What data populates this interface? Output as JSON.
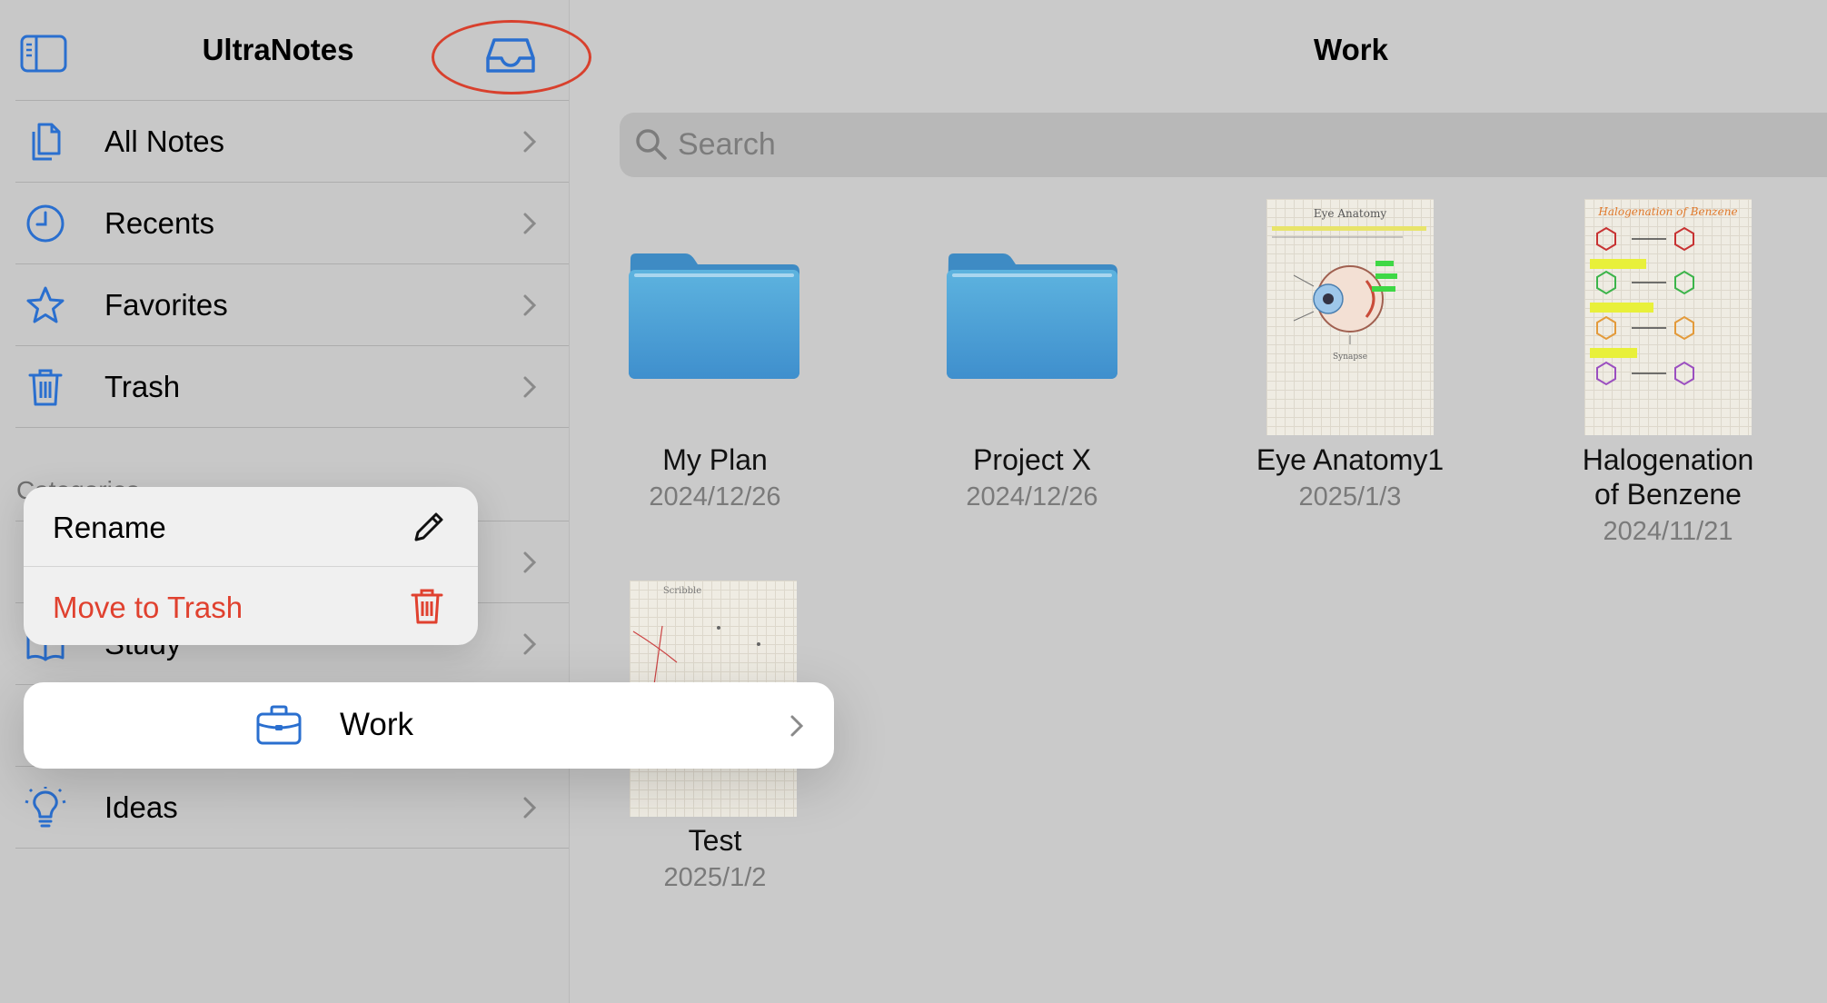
{
  "colors": {
    "accent": "#2a6fcf",
    "danger": "#e0412f",
    "folder": "#4ba3d6",
    "annotation": "#d8402d"
  },
  "sidebar": {
    "title": "UltraNotes",
    "toggle_icon": "sidebar-toggle-icon",
    "inbox_icon": "inbox-tray-icon",
    "items": [
      {
        "label": "All Notes",
        "icon": "documents-icon"
      },
      {
        "label": "Recents",
        "icon": "clock-icon"
      },
      {
        "label": "Favorites",
        "icon": "star-icon"
      },
      {
        "label": "Trash",
        "icon": "trash-icon"
      }
    ],
    "section_label": "Categories",
    "categories": [
      {
        "label": "",
        "icon": ""
      },
      {
        "label": "Study",
        "icon": "book-icon"
      },
      {
        "label": "Work",
        "icon": "briefcase-icon"
      },
      {
        "label": "Ideas",
        "icon": "lightbulb-icon"
      }
    ]
  },
  "main": {
    "title": "Work",
    "search_placeholder": "Search",
    "items": [
      {
        "name": "My Plan",
        "date": "2024/12/26",
        "kind": "folder"
      },
      {
        "name": "Project X",
        "date": "2024/12/26",
        "kind": "folder"
      },
      {
        "name": "Eye Anatomy1",
        "date": "2025/1/3",
        "kind": "note"
      },
      {
        "name_line1": "Halogenation",
        "name_line2": "of Benzene",
        "date": "2024/11/21",
        "kind": "note"
      },
      {
        "name": "Test",
        "date": "2025/1/2",
        "kind": "note"
      }
    ],
    "thumb_text": {
      "eye_title": "Eye Anatomy",
      "benzene_title": "Halogenation of Benzene",
      "test_title": "Scribble"
    }
  },
  "context_menu": {
    "rename_label": "Rename",
    "rename_icon": "pencil-icon",
    "trash_label": "Move to Trash",
    "trash_icon": "trash-icon"
  },
  "selected_card": {
    "label": "Work",
    "icon": "briefcase-icon"
  }
}
